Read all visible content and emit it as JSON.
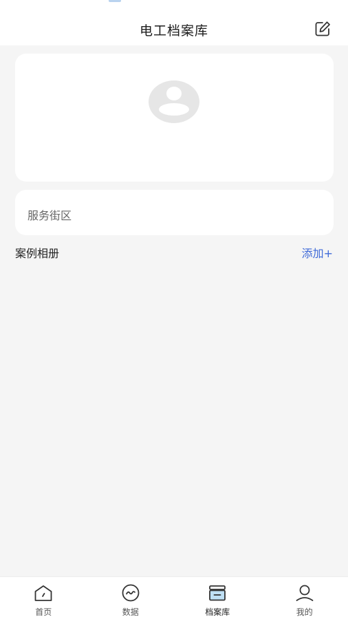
{
  "header": {
    "title": "电工档案库",
    "edit_icon": "edit-icon"
  },
  "photo_card": {
    "avatar_icon": "avatar-placeholder-icon"
  },
  "district_card": {
    "text": "服务街区"
  },
  "cases": {
    "title": "案例相册",
    "add_label": "添加+"
  },
  "tabbar": {
    "active_index": 2,
    "items": [
      {
        "label": "首页",
        "icon": "home-icon"
      },
      {
        "label": "数据",
        "icon": "data-chart-icon"
      },
      {
        "label": "档案库",
        "icon": "archive-box-icon"
      },
      {
        "label": "我的",
        "icon": "user-icon"
      }
    ]
  },
  "colors": {
    "background": "#f5f5f5",
    "card": "#ffffff",
    "accent_link": "#3f6ad8",
    "archive_active_fill": "#bfe0f5"
  }
}
